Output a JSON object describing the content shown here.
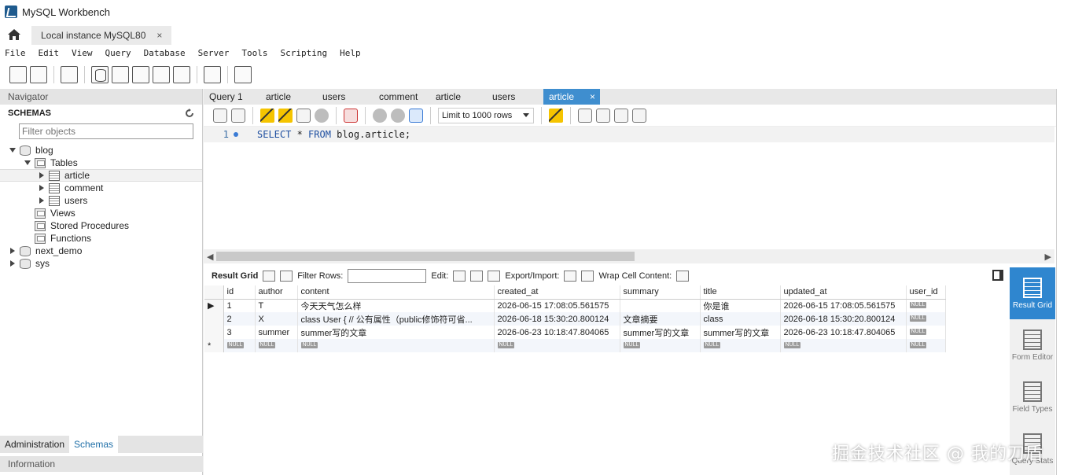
{
  "window": {
    "title": "MySQL Workbench"
  },
  "connection_tab": {
    "label": "Local instance MySQL80",
    "close": "×"
  },
  "menu": [
    "File",
    "Edit",
    "View",
    "Query",
    "Database",
    "Server",
    "Tools",
    "Scripting",
    "Help"
  ],
  "navigator": {
    "header": "Navigator",
    "schemas_label": "SCHEMAS",
    "filter_placeholder": "Filter objects",
    "tree": {
      "blog": "blog",
      "tables": "Tables",
      "article": "article",
      "comment": "comment",
      "users": "users",
      "views": "Views",
      "stored_procedures": "Stored Procedures",
      "functions": "Functions",
      "next_demo": "next_demo",
      "sys": "sys"
    },
    "bottom_tabs": {
      "administration": "Administration",
      "schemas": "Schemas"
    },
    "information": "Information"
  },
  "query_tabs": [
    {
      "label": "Query 1"
    },
    {
      "label": "article"
    },
    {
      "label": "users"
    },
    {
      "label": "comment"
    },
    {
      "label": "article"
    },
    {
      "label": "users"
    },
    {
      "label": "article",
      "close": "×"
    }
  ],
  "query_toolbar": {
    "limit": "Limit to 1000 rows"
  },
  "editor": {
    "line_number": "1",
    "sql_kw1": "SELECT",
    "sql_mid": " * ",
    "sql_kw2": "FROM",
    "sql_rest": " blog.article;"
  },
  "result_toolbar": {
    "result_grid": "Result Grid",
    "filter_rows": "Filter Rows:",
    "edit": "Edit:",
    "export_import": "Export/Import:",
    "wrap": "Wrap Cell Content:"
  },
  "grid": {
    "columns": [
      "id",
      "author",
      "content",
      "created_at",
      "summary",
      "title",
      "updated_at",
      "user_id"
    ],
    "rows": [
      [
        "1",
        "T",
        "今天天气怎么样",
        "2026-06-15 17:08:05.561575",
        "",
        "你是谁",
        "2026-06-15 17:08:05.561575",
        "NULL"
      ],
      [
        "2",
        "X",
        "class User {  // 公有属性（public修饰符可省...",
        "2026-06-18 15:30:20.800124",
        "文章摘要",
        "class",
        "2026-06-18 15:30:20.800124",
        "NULL"
      ],
      [
        "3",
        "summer",
        "summer写的文章",
        "2026-06-23 10:18:47.804065",
        "summer写的文章",
        "summer写的文章",
        "2026-06-23 10:18:47.804065",
        "NULL"
      ]
    ],
    "null_label": "NULL"
  },
  "right_panel": {
    "result_grid": "Result Grid",
    "form_editor": "Form Editor",
    "field_types": "Field Types",
    "query_stats": "Query Stats"
  },
  "watermark": "掘金技术社区 @ 我的刀盾",
  "colors": {
    "accent": "#2f86cf",
    "active_tab": "#3f8ecf",
    "keyword": "#1f4fa0"
  }
}
